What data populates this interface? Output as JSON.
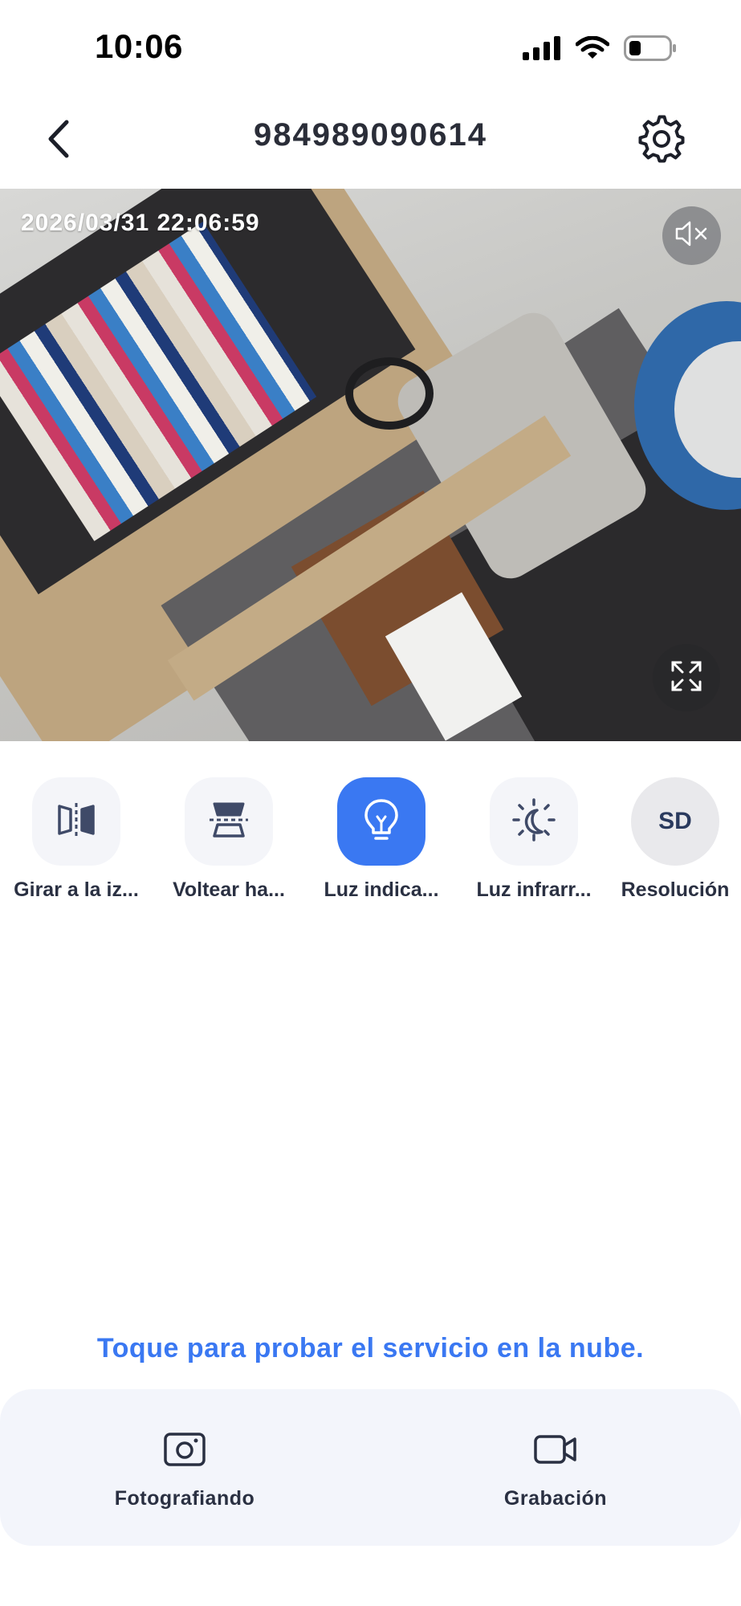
{
  "status_bar": {
    "time": "10:06",
    "icons": [
      "signal-icon",
      "wifi-icon",
      "battery-icon"
    ]
  },
  "header": {
    "title": "984989090614",
    "back_icon": "chevron-left-icon",
    "settings_icon": "gear-icon"
  },
  "video": {
    "timestamp": "2026/03/31 22:06:59",
    "mute_icon": "speaker-muted-icon",
    "fullscreen_icon": "expand-icon"
  },
  "controls": [
    {
      "label": "Girar a la iz...",
      "icon": "mirror-flip-icon",
      "active": false
    },
    {
      "label": "Voltear ha...",
      "icon": "flip-vertical-icon",
      "active": false
    },
    {
      "label": "Luz indica...",
      "icon": "lightbulb-icon",
      "active": true
    },
    {
      "label": "Luz infrarr...",
      "icon": "night-vision-icon",
      "active": false
    },
    {
      "label": "Resolución",
      "icon": "resolution-badge",
      "badge_text": "SD",
      "active": false
    }
  ],
  "cloud": {
    "text": "Toque para probar el servicio en la nube."
  },
  "bottom_actions": [
    {
      "label": "Fotografiando",
      "icon": "camera-icon"
    },
    {
      "label": "Grabación",
      "icon": "video-camera-icon"
    }
  ],
  "colors": {
    "accent": "#3a78f2",
    "panel_bg": "#f3f5fb",
    "button_bg": "#f4f5f9",
    "text_dark": "#2a3042"
  }
}
